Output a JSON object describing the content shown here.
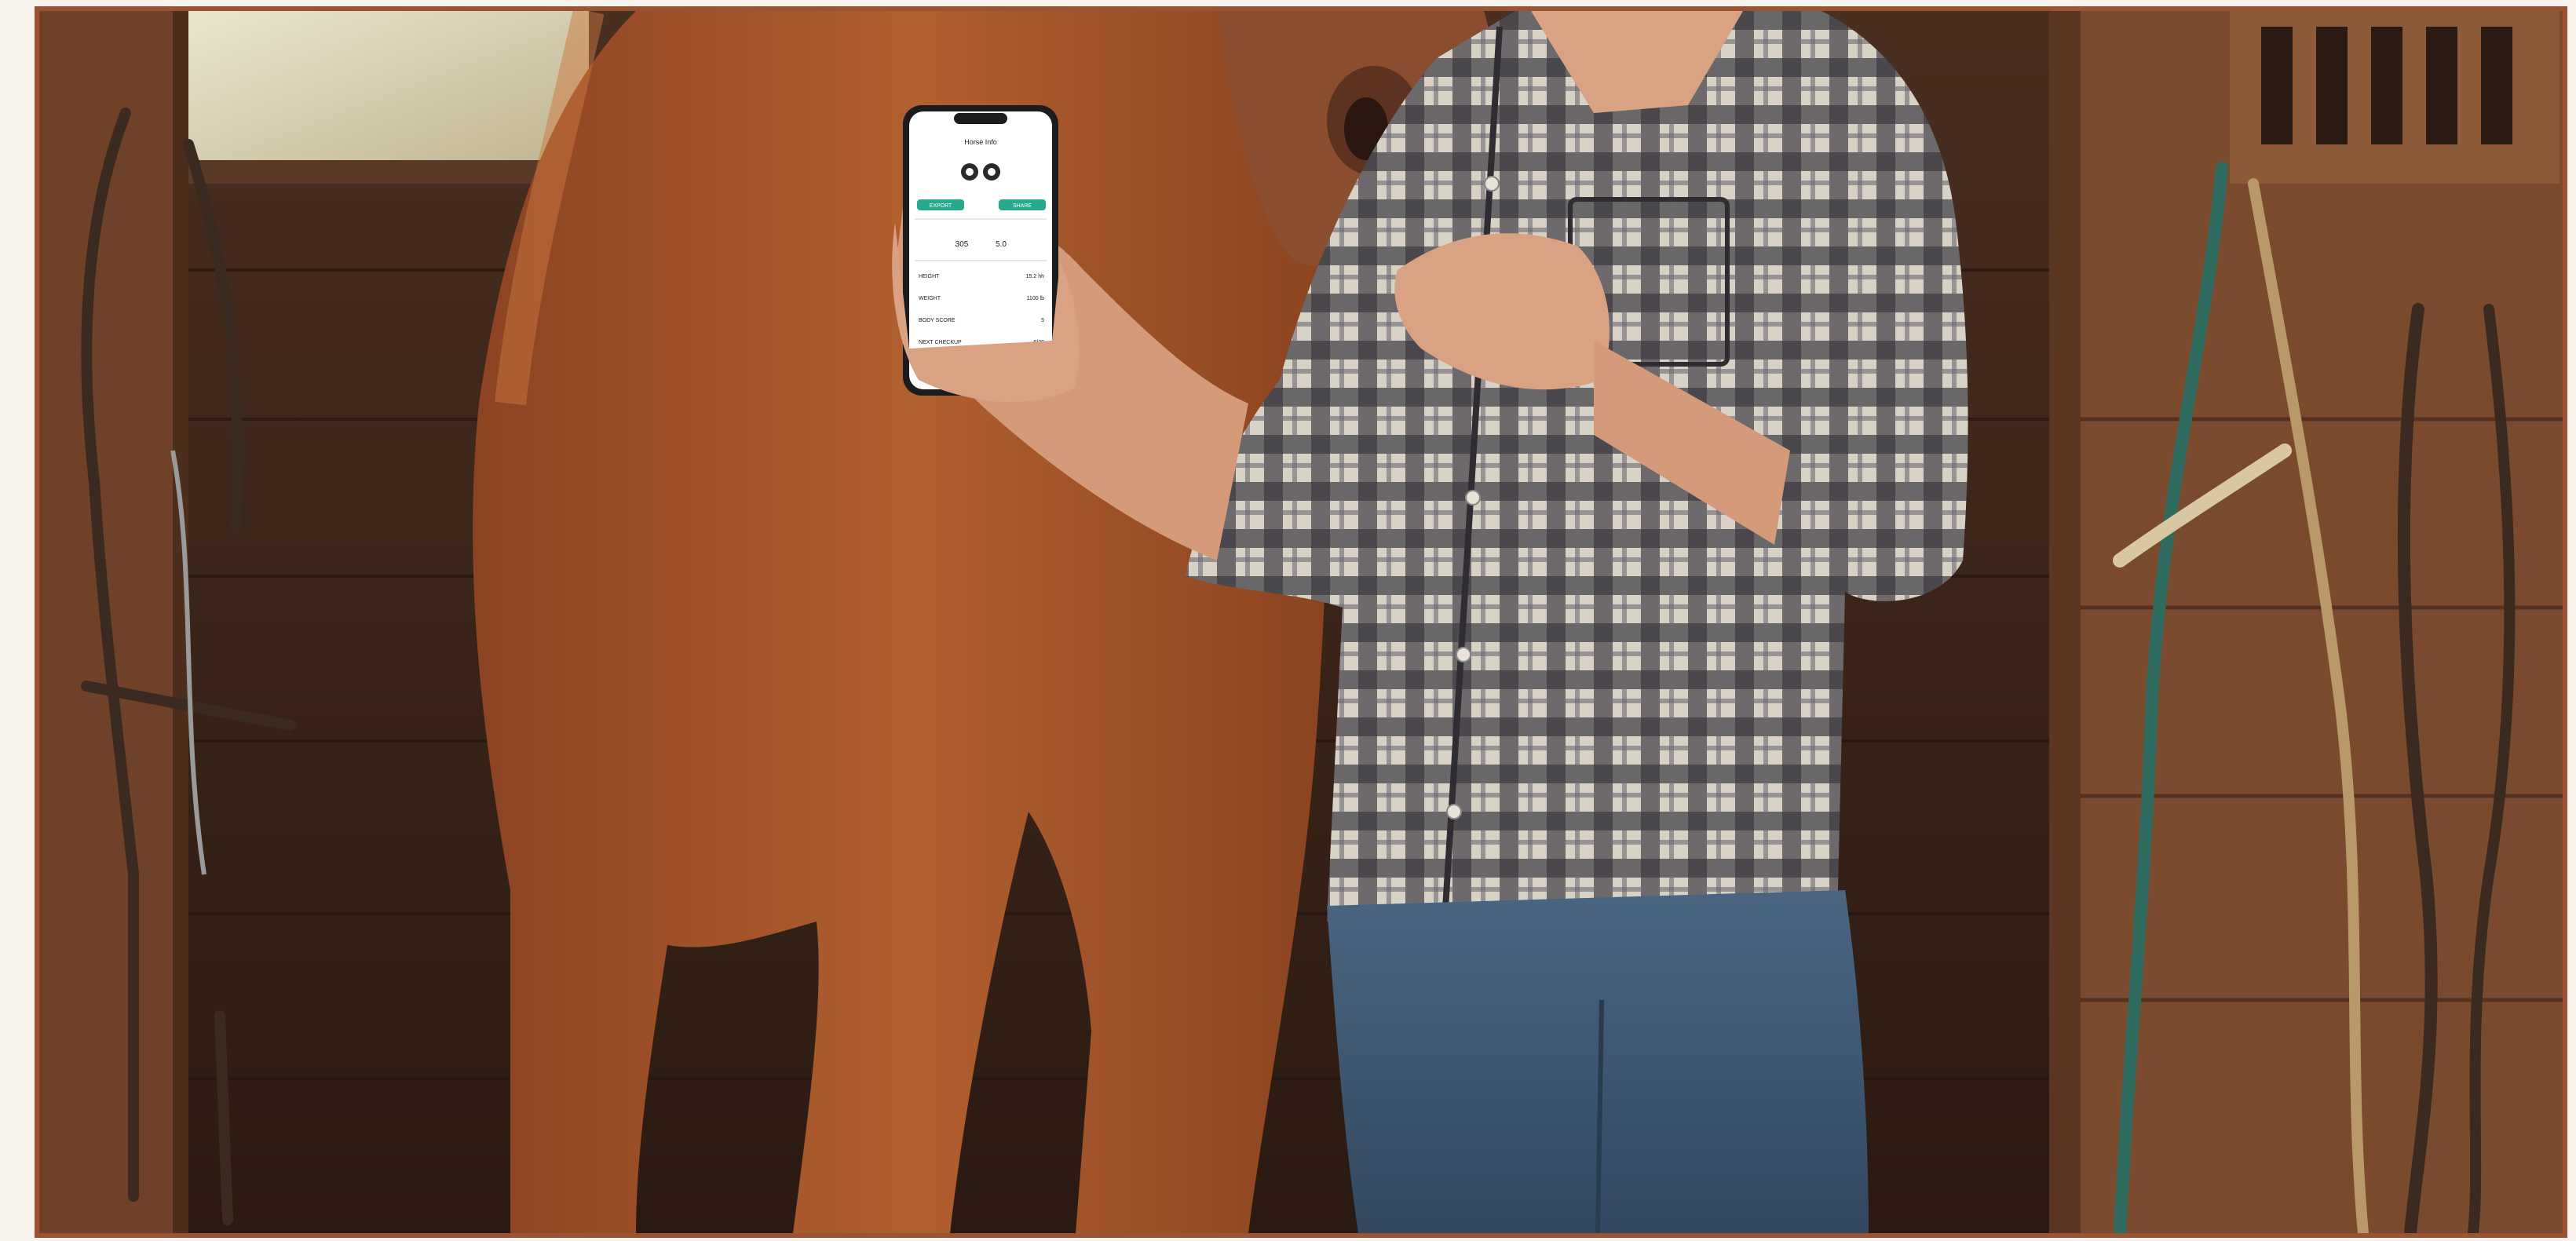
{
  "photo": {
    "subject": "horse-and-woman-with-phone",
    "accent_colors": {
      "frame": "#9a5433",
      "horse_coat": "#a4552a",
      "shirt_dark": "#3d3b40",
      "shirt_light": "#d9d3c8",
      "jeans": "#3e5670",
      "wood": "#7a4a2e",
      "app_accent": "#27a98d"
    }
  },
  "phone_app": {
    "header_title": "Horse Info",
    "left_badge": "EXPORT",
    "right_badge": "SHARE",
    "stat_1": "305",
    "stat_2": "5.0",
    "rows": [
      {
        "label": "HEIGHT",
        "value": "15.2 hh"
      },
      {
        "label": "WEIGHT",
        "value": "1100 lb"
      },
      {
        "label": "BODY SCORE",
        "value": "5"
      },
      {
        "label": "NEXT CHECKUP",
        "value": "6/20"
      }
    ]
  }
}
